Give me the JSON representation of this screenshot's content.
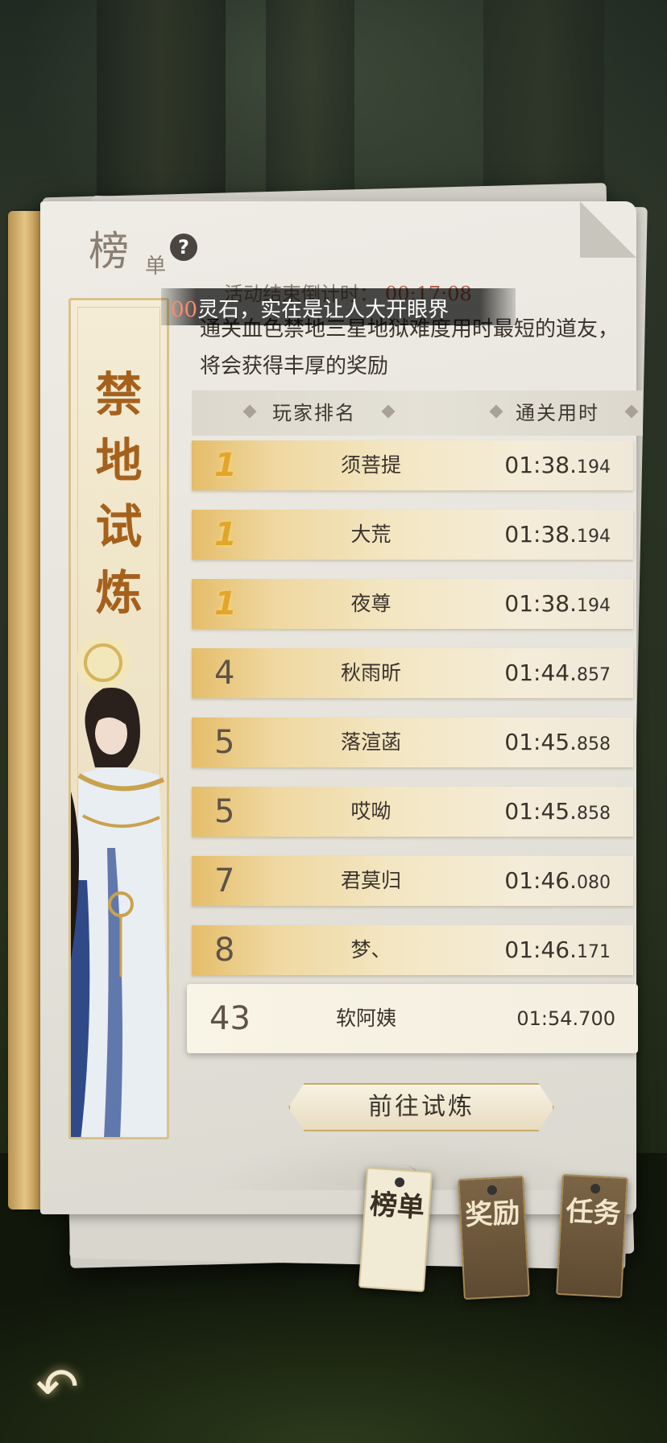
{
  "header": {
    "title_main": "榜",
    "title_sub": "单",
    "help_icon": "question-circle-icon"
  },
  "banner": {
    "chars": [
      "禁",
      "地",
      "试",
      "炼"
    ]
  },
  "event": {
    "countdown_label": "活动结束倒计时：",
    "countdown_value": "00:17:08",
    "marquee_prefix": "00",
    "marquee_text": "灵石，实在是让人大开眼界",
    "description": "通关血色禁地三星地狱难度用时最短的道友，将会获得丰厚的奖励"
  },
  "table": {
    "col_player": "玩家排名",
    "col_time": "通关用时",
    "rows": [
      {
        "rank": "1",
        "name": "须菩提",
        "time_main": "01:38.",
        "time_ms": "194"
      },
      {
        "rank": "1",
        "name": "大荒",
        "time_main": "01:38.",
        "time_ms": "194"
      },
      {
        "rank": "1",
        "name": "夜尊",
        "time_main": "01:38.",
        "time_ms": "194"
      },
      {
        "rank": "4",
        "name": "秋雨昕",
        "time_main": "01:44.",
        "time_ms": "857"
      },
      {
        "rank": "5",
        "name": "落渲菡",
        "time_main": "01:45.",
        "time_ms": "858"
      },
      {
        "rank": "5",
        "name": "哎呦",
        "time_main": "01:45.",
        "time_ms": "858"
      },
      {
        "rank": "7",
        "name": "君莫归",
        "time_main": "01:46.",
        "time_ms": "080"
      },
      {
        "rank": "8",
        "name": "梦、",
        "time_main": "01:46.",
        "time_ms": "171"
      }
    ],
    "my_row": {
      "rank": "43",
      "name": "软阿姨",
      "time": "01:54.700"
    }
  },
  "actions": {
    "go_trial": "前往试炼"
  },
  "tabs": [
    {
      "label": "榜单",
      "active": true
    },
    {
      "label": "奖励",
      "active": false
    },
    {
      "label": "任务",
      "active": false
    }
  ],
  "back_icon": "back-arrow-icon"
}
